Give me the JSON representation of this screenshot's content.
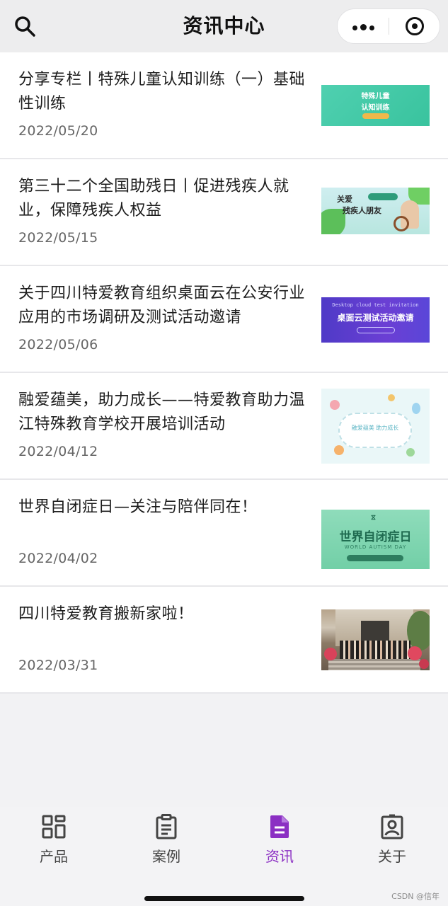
{
  "header": {
    "title": "资讯中心",
    "search_icon": "search-icon",
    "more_icon": "more-dots-icon",
    "close_icon": "target-close-icon"
  },
  "news": [
    {
      "title": "分享专栏丨特殊儿童认知训练（一）基础性训练",
      "date": "2022/05/20",
      "thumb_text": [
        "特殊儿童",
        "认知训练"
      ]
    },
    {
      "title": "第三十二个全国助残日丨促进残疾人就业，保障残疾人权益",
      "date": "2022/05/15",
      "thumb_text": [
        "关爱",
        "残疾人朋友"
      ]
    },
    {
      "title": "关于四川特爱教育组织桌面云在公安行业应用的市场调研及测试活动邀请",
      "date": "2022/05/06",
      "thumb_text": [
        "Desktop cloud test invitation",
        "桌面云测试活动邀请"
      ]
    },
    {
      "title": "融爱蕴美，助力成长——特爱教育助力温江特殊教育学校开展培训活动",
      "date": "2022/04/12",
      "thumb_text": [
        "融爱蕴美 助力成长"
      ]
    },
    {
      "title": "世界自闭症日—关注与陪伴同在！",
      "date": "2022/04/02",
      "thumb_text": [
        "世界自闭症日",
        "WORLD AUTISM DAY"
      ]
    },
    {
      "title": "四川特爱教育搬新家啦！",
      "date": "2022/03/31",
      "thumb_text": []
    }
  ],
  "tabs": [
    {
      "label": "产品",
      "icon": "grid-icon",
      "active": false
    },
    {
      "label": "案例",
      "icon": "clipboard-icon",
      "active": false
    },
    {
      "label": "资讯",
      "icon": "document-icon",
      "active": true
    },
    {
      "label": "关于",
      "icon": "badge-icon",
      "active": false
    }
  ],
  "colors": {
    "accent": "#8b2fc3",
    "text": "#1d1d1d",
    "date": "#666666"
  },
  "watermark": "CSDN @信年"
}
